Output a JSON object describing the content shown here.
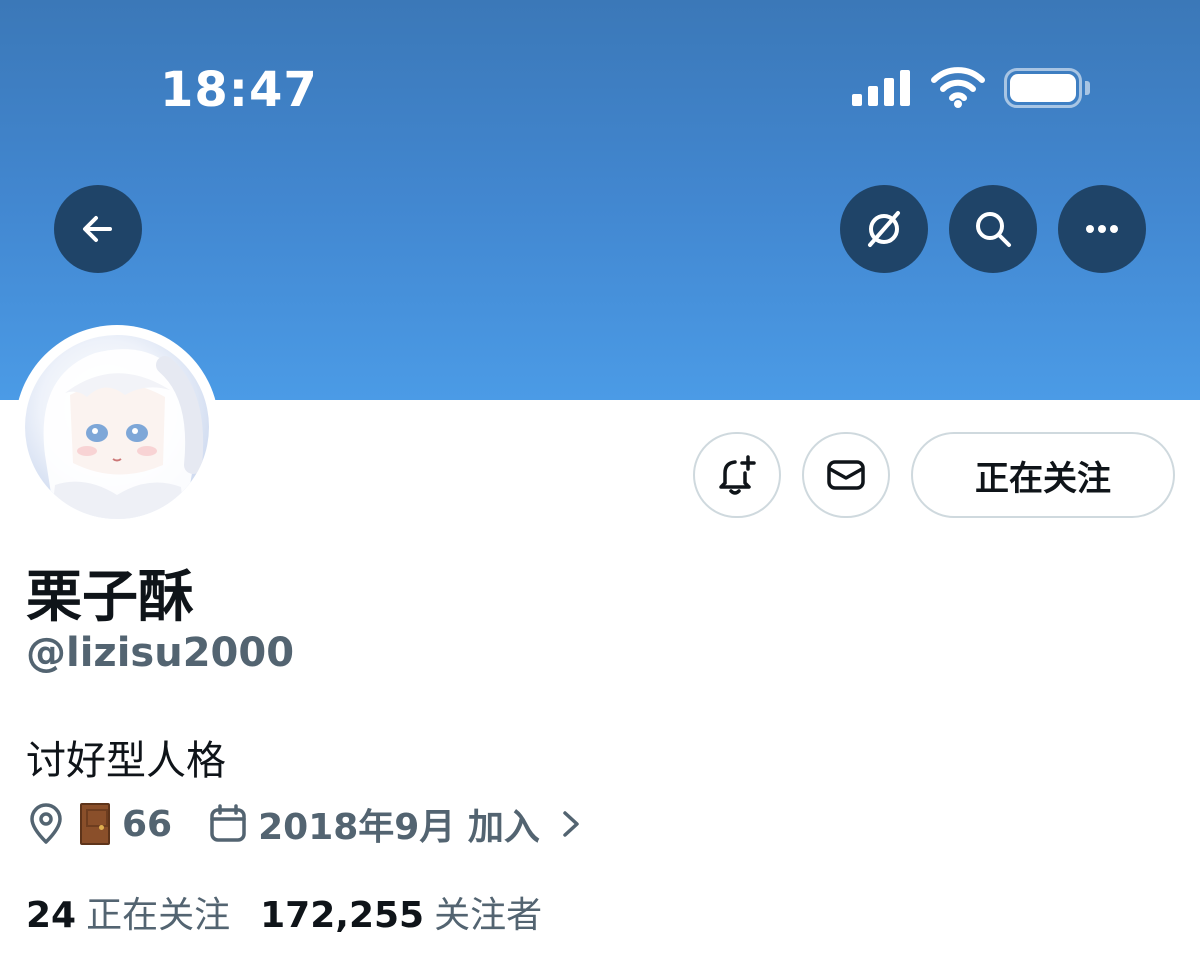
{
  "status_bar": {
    "time": "18:47"
  },
  "profile": {
    "display_name": "栗子酥",
    "handle": "@lizisu2000",
    "bio": "讨好型人格",
    "location": "66",
    "joined": "2018年9月 加入",
    "following_count": "24",
    "following_label": "正在关注",
    "followers_count": "172,255",
    "followers_label": "关注者"
  },
  "actions": {
    "follow_state_label": "正在关注"
  },
  "icons": {
    "back": "arrow-left-icon",
    "translate": "no-translate-icon",
    "search": "search-icon",
    "more": "more-icon",
    "notify": "bell-plus-icon",
    "message": "envelope-icon",
    "location": "location-pin-icon",
    "location_emoji": "door-emoji",
    "calendar": "calendar-icon"
  },
  "colors": {
    "banner_top": "#3b78b8",
    "banner_bottom": "#4b9be6",
    "circle_button": "#1f4468",
    "secondary_text": "#536471",
    "primary_text": "#0f1419"
  }
}
